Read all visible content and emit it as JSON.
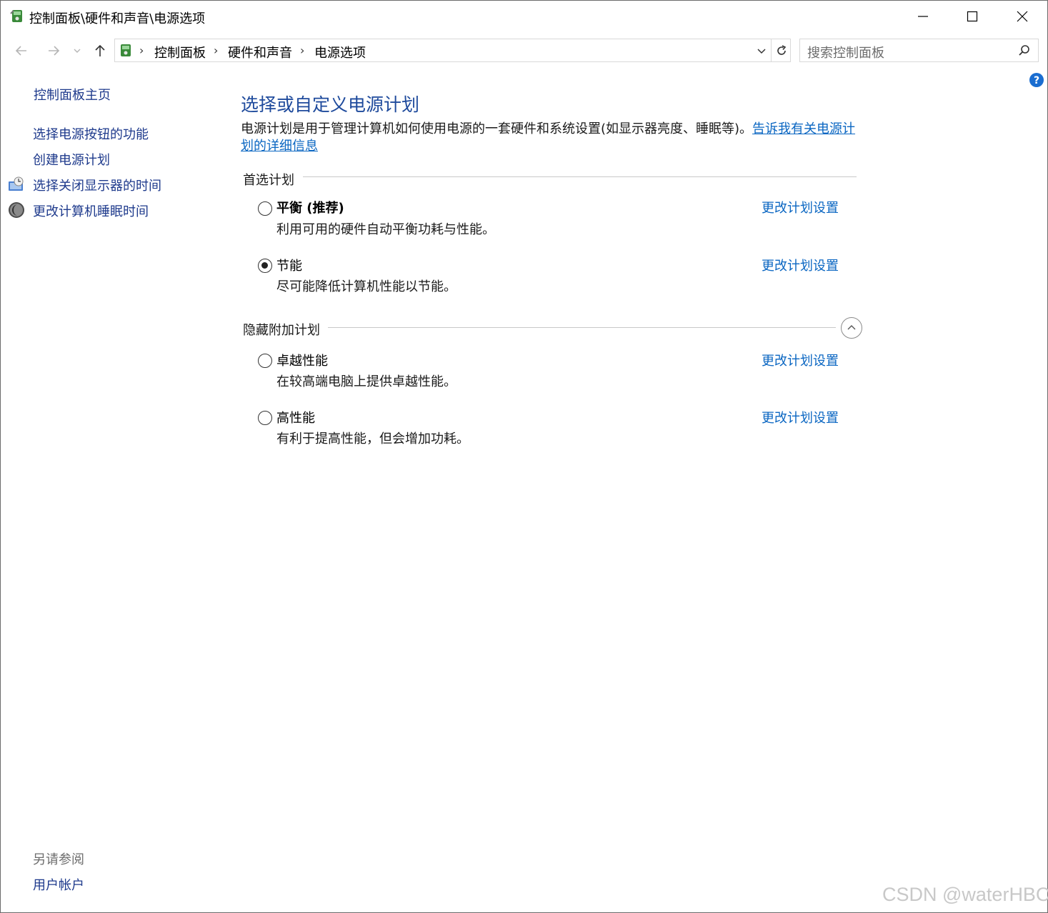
{
  "window": {
    "title": "控制面板\\硬件和声音\\电源选项"
  },
  "address_bar": {
    "breadcrumbs": [
      "控制面板",
      "硬件和声音",
      "电源选项"
    ]
  },
  "search": {
    "placeholder": "搜索控制面板"
  },
  "left_nav": {
    "home": "控制面板主页",
    "items": [
      {
        "label": "选择电源按钮的功能"
      },
      {
        "label": "创建电源计划"
      },
      {
        "label": "选择关闭显示器的时间",
        "icon": "monitor-clock-icon"
      },
      {
        "label": "更改计算机睡眠时间",
        "icon": "moon-icon"
      }
    ],
    "see_also_heading": "另请参阅",
    "see_also_items": [
      {
        "label": "用户帐户"
      }
    ]
  },
  "main": {
    "title": "选择或自定义电源计划",
    "description": "电源计划是用于管理计算机如何使用电源的一套硬件和系统设置(如显示器亮度、睡眠等)。",
    "description_link": "告诉我有关电源计划的详细信息",
    "preferred_heading": "首选计划",
    "hidden_heading": "隐藏附加计划",
    "preferred_plans": [
      {
        "name": "平衡 (推荐)",
        "desc": "利用可用的硬件自动平衡功耗与性能。",
        "link": "更改计划设置",
        "selected": false
      },
      {
        "name": "节能",
        "desc": "尽可能降低计算机性能以节能。",
        "link": "更改计划设置",
        "selected": true
      }
    ],
    "hidden_plans": [
      {
        "name": "卓越性能",
        "desc": "在较高端电脑上提供卓越性能。",
        "link": "更改计划设置",
        "selected": false
      },
      {
        "name": "高性能",
        "desc": "有利于提高性能，但会增加功耗。",
        "link": "更改计划设置",
        "selected": false
      }
    ]
  },
  "watermark": "CSDN @waterHBO",
  "colors": {
    "link": "#0a66c2",
    "nav_link": "#1e3a8c",
    "title": "#1e4a9c"
  }
}
